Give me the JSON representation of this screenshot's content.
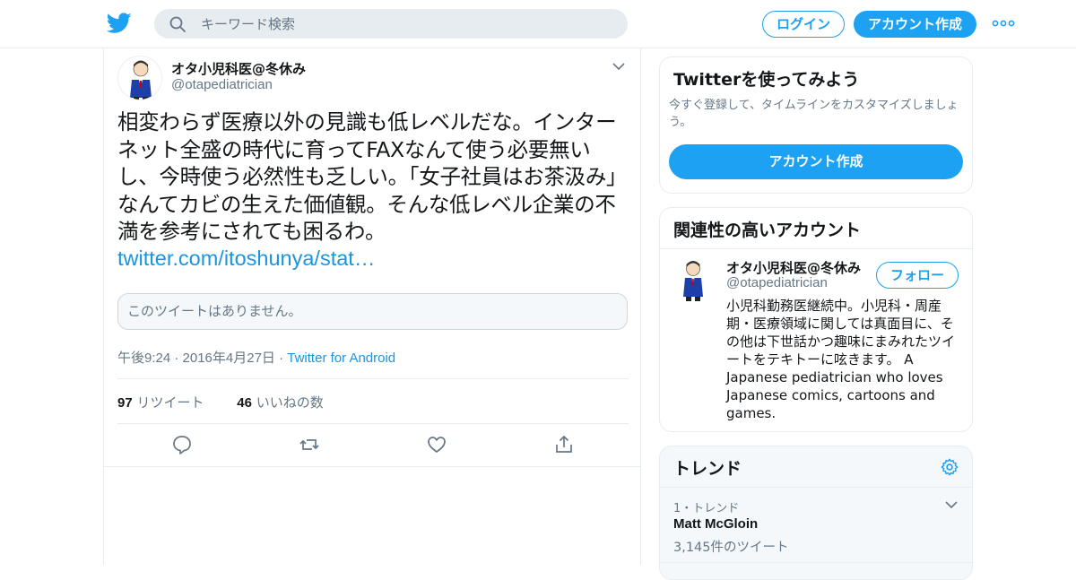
{
  "header": {
    "search_placeholder": "キーワード検索",
    "login_label": "ログイン",
    "signup_label": "アカウント作成"
  },
  "tweet": {
    "author_name": "オタ小児科医@冬休み",
    "author_handle": "@otapediatrician",
    "text": "相変わらず医療以外の見識も低レベルだな。インターネット全盛の時代に育ってFAXなんて使う必要無いし、今時使う必然性も乏しい。「女子社員はお茶汲み」なんてカビの生えた価値観。そんな低レベル企業の不満を参考にされても困るわ。",
    "link": "twitter.com/itoshunya/stat…",
    "quote_unavailable": "このツイートはありません。",
    "time": "午後9:24 · 2016年4月27日 · ",
    "source": "Twitter for Android",
    "retweet_count": "97",
    "retweet_label": "リツイート",
    "like_count": "46",
    "like_label": "いいねの数"
  },
  "sidebar": {
    "signup_card": {
      "title": "Twitterを使ってみよう",
      "desc": "今すぐ登録して、タイムラインをカスタマイズしましょう。",
      "button": "アカウント作成"
    },
    "related": {
      "title": "関連性の高いアカウント",
      "name": "オタ小児科医@冬休み",
      "handle": "@otapediatrician",
      "follow_label": "フォロー",
      "bio": "小児科勤務医継続中。小児科・周産期・医療領域に関しては真面目に、その他は下世話かつ趣味にまみれたツイートをテキトーに呟きます。 A Japanese pediatrician who loves Japanese comics, cartoons and games."
    },
    "trends": {
      "title": "トレンド",
      "items": [
        {
          "rank": "1・トレンド",
          "name": "Matt McGloin",
          "count": "3,145件のツイート"
        }
      ]
    }
  },
  "colors": {
    "accent": "#1da1f2",
    "link": "#1b95e0",
    "muted": "#657786",
    "border": "#e6ecf0"
  }
}
